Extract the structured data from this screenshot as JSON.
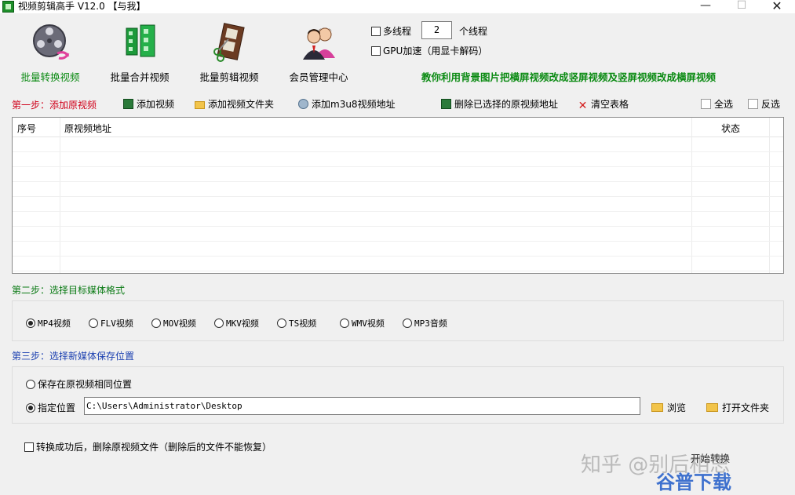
{
  "window": {
    "title": "视频剪辑高手 V12.0  【与我】",
    "min_glyph": "—",
    "max_glyph": "☐",
    "close_glyph": "✕"
  },
  "toolbar": {
    "items": [
      {
        "label": "批量转换视频",
        "icon": "film-reel-icon"
      },
      {
        "label": "批量合并视频",
        "icon": "film-merge-icon"
      },
      {
        "label": "批量剪辑视频",
        "icon": "film-scissors-icon"
      },
      {
        "label": "会员管理中心",
        "icon": "members-icon"
      }
    ]
  },
  "options": {
    "multithread_label": "多线程",
    "thread_count": "2",
    "thread_unit": "个线程",
    "gpu_label": "GPU加速（用显卡解码）"
  },
  "tip": "教你利用背景图片把横屏视频改成竖屏视频及竖屏视频改成横屏视频",
  "step1": {
    "title": "第一步：添加原视频",
    "actions": {
      "add_video": "添加视频",
      "add_folder": "添加视频文件夹",
      "add_m3u8": "添加m3u8视频地址",
      "delete_selected": "删除已选择的原视频地址",
      "clear_table": "清空表格",
      "select_all": "全选",
      "invert": "反选"
    },
    "table": {
      "col_index": "序号",
      "col_path": "原视频地址",
      "col_status": "状态"
    }
  },
  "step2": {
    "title": "第二步：选择目标媒体格式",
    "formats": [
      "MP4视频",
      "FLV视频",
      "MOV视频",
      "MKV视频",
      "TS视频",
      "WMV视频",
      "MP3音频"
    ],
    "selected": "MP4视频"
  },
  "step3": {
    "title": "第三步：选择新媒体保存位置",
    "same_location": "保存在原视频相同位置",
    "specified_location": "指定位置",
    "path_value": "C:\\Users\\Administrator\\Desktop",
    "browse": "浏览",
    "open_folder": "打开文件夹"
  },
  "delete_after": "转换成功后，删除原视频文件（删除后的文件不能恢复）",
  "start_button": "开始转换",
  "watermark": {
    "line1": "知乎 @别后相思",
    "line2": "谷普下载"
  },
  "colors": {
    "accent_green": "#0a8a12",
    "step1_red": "#d0021b",
    "step3_blue": "#1a3fb0"
  }
}
